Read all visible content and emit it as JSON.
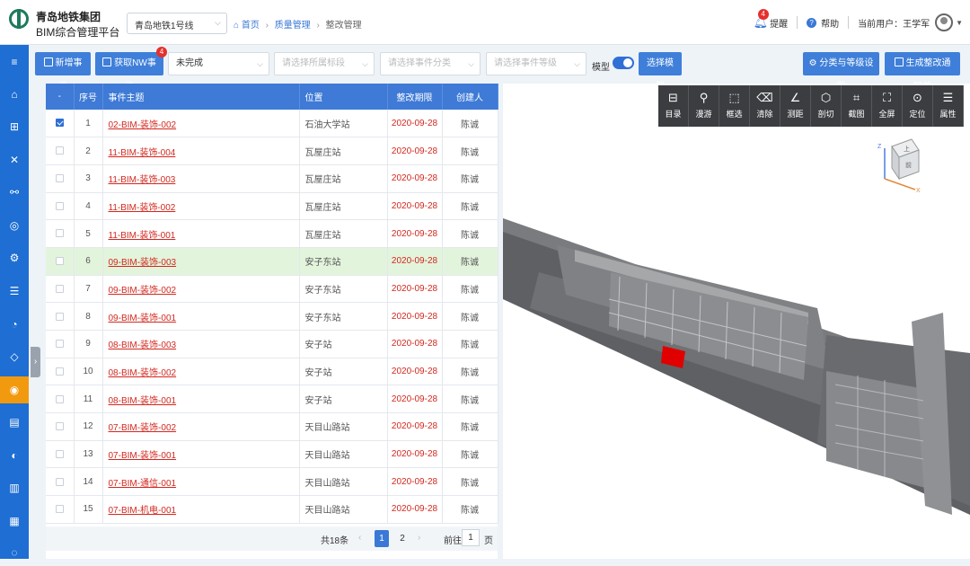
{
  "header": {
    "brand_line1": "青岛地铁集团",
    "brand_line2": "BIM综合管理平台",
    "line_select": "青岛地铁1号线",
    "breadcrumb": [
      "首页",
      "质量管理",
      "整改管理"
    ],
    "reminder_label": "提醒",
    "reminder_count": "4",
    "help_label": "帮助",
    "current_user_label": "当前用户：",
    "user_name": "王学军"
  },
  "toolbar": {
    "new_event": "新增事件",
    "fetch_nw": "获取NW事件",
    "fetch_nw_badge": "4",
    "status_filter": "未完成",
    "section_placeholder": "请选择所属标段",
    "category_placeholder": "请选择事件分类",
    "level_placeholder": "请选择事件等级",
    "model_label": "模型",
    "model_toggle": true,
    "select_model": "选择模型",
    "classify_settings": "分类与等级设置",
    "generate_notice": "生成整改通知单"
  },
  "table": {
    "columns": [
      "-",
      "序号",
      "事件主题",
      "位置",
      "整改期限",
      "创建人"
    ],
    "rows": [
      {
        "checked": true,
        "no": "1",
        "subject": "02-BIM-装饰-002",
        "location": "石油大学站",
        "deadline": "2020-09-28",
        "creator": "陈诚"
      },
      {
        "checked": false,
        "no": "2",
        "subject": "11-BIM-装饰-004",
        "location": "瓦屋庄站",
        "deadline": "2020-09-28",
        "creator": "陈诚"
      },
      {
        "checked": false,
        "no": "3",
        "subject": "11-BIM-装饰-003",
        "location": "瓦屋庄站",
        "deadline": "2020-09-28",
        "creator": "陈诚"
      },
      {
        "checked": false,
        "no": "4",
        "subject": "11-BIM-装饰-002",
        "location": "瓦屋庄站",
        "deadline": "2020-09-28",
        "creator": "陈诚"
      },
      {
        "checked": false,
        "no": "5",
        "subject": "11-BIM-装饰-001",
        "location": "瓦屋庄站",
        "deadline": "2020-09-28",
        "creator": "陈诚"
      },
      {
        "checked": false,
        "no": "6",
        "subject": "09-BIM-装饰-003",
        "location": "安子东站",
        "deadline": "2020-09-28",
        "creator": "陈诚",
        "highlight": true
      },
      {
        "checked": false,
        "no": "7",
        "subject": "09-BIM-装饰-002",
        "location": "安子东站",
        "deadline": "2020-09-28",
        "creator": "陈诚"
      },
      {
        "checked": false,
        "no": "8",
        "subject": "09-BIM-装饰-001",
        "location": "安子东站",
        "deadline": "2020-09-28",
        "creator": "陈诚"
      },
      {
        "checked": false,
        "no": "9",
        "subject": "08-BIM-装饰-003",
        "location": "安子站",
        "deadline": "2020-09-28",
        "creator": "陈诚"
      },
      {
        "checked": false,
        "no": "10",
        "subject": "08-BIM-装饰-002",
        "location": "安子站",
        "deadline": "2020-09-28",
        "creator": "陈诚"
      },
      {
        "checked": false,
        "no": "11",
        "subject": "08-BIM-装饰-001",
        "location": "安子站",
        "deadline": "2020-09-28",
        "creator": "陈诚"
      },
      {
        "checked": false,
        "no": "12",
        "subject": "07-BIM-装饰-002",
        "location": "天目山路站",
        "deadline": "2020-09-28",
        "creator": "陈诚"
      },
      {
        "checked": false,
        "no": "13",
        "subject": "07-BIM-装饰-001",
        "location": "天目山路站",
        "deadline": "2020-09-28",
        "creator": "陈诚"
      },
      {
        "checked": false,
        "no": "14",
        "subject": "07-BIM-通信-001",
        "location": "天目山路站",
        "deadline": "2020-09-28",
        "creator": "陈诚"
      },
      {
        "checked": false,
        "no": "15",
        "subject": "07-BIM-机电-001",
        "location": "天目山路站",
        "deadline": "2020-09-28",
        "creator": "陈诚"
      }
    ]
  },
  "pagination": {
    "total": "共18条",
    "pages": [
      "1",
      "2"
    ],
    "current": "1",
    "goto_label": "前往",
    "goto_value": "1",
    "page_unit": "页"
  },
  "viewer": {
    "tools": [
      {
        "label": "目录",
        "icon": "catalog-icon",
        "glyph": "⊟"
      },
      {
        "label": "漫游",
        "icon": "walk-icon",
        "glyph": "⚲"
      },
      {
        "label": "框选",
        "icon": "box-select-icon",
        "glyph": "⬚"
      },
      {
        "label": "清除",
        "icon": "clear-icon",
        "glyph": "⌫"
      },
      {
        "label": "测距",
        "icon": "measure-icon",
        "glyph": "∠"
      },
      {
        "label": "剖切",
        "icon": "section-icon",
        "glyph": "⬡"
      },
      {
        "label": "截图",
        "icon": "screenshot-icon",
        "glyph": "⌗"
      },
      {
        "label": "全屏",
        "icon": "fullscreen-icon",
        "glyph": "⛶"
      },
      {
        "label": "定位",
        "icon": "locate-icon",
        "glyph": "⊙"
      },
      {
        "label": "属性",
        "icon": "properties-icon",
        "glyph": "☰"
      }
    ],
    "cube_top": "上",
    "cube_front": "前",
    "axis_z": "Z",
    "axis_x": "X"
  },
  "sidebar": {
    "icons": [
      "menu-icon",
      "home-icon",
      "org-icon",
      "tools-icon",
      "flow-icon",
      "qa-icon",
      "settings-icon",
      "sliders-icon",
      "chart-pie-icon",
      "shield-icon",
      "quality-icon",
      "document-icon",
      "cost-icon",
      "bar-chart-icon",
      "report-icon",
      "more-icon"
    ],
    "active_index": 10
  }
}
